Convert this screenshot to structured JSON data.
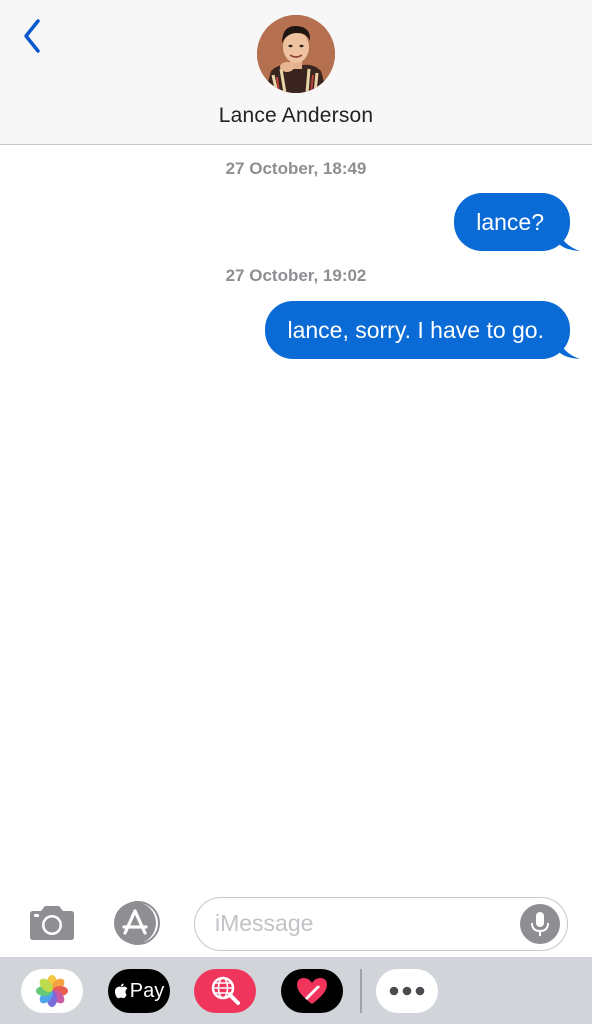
{
  "header": {
    "back_icon": "chevron-left-icon",
    "avatar_icon": "contact-photo",
    "contact_name": "Lance Anderson"
  },
  "messages": [
    {
      "timestamp": "27 October, 18:49",
      "text": "lance?",
      "direction": "outgoing"
    },
    {
      "timestamp": "27 October, 19:02",
      "text": "lance, sorry. I have to go.",
      "direction": "outgoing"
    }
  ],
  "compose": {
    "camera_icon": "camera-icon",
    "appstore_icon": "app-store-icon",
    "placeholder": "iMessage",
    "value": "",
    "mic_icon": "microphone-icon"
  },
  "drawer": {
    "apps": [
      {
        "name": "photos",
        "icon": "photos-flower-icon"
      },
      {
        "name": "apple-pay",
        "label": "Pay",
        "icon": "apple-logo-icon"
      },
      {
        "name": "images-search",
        "icon": "globe-magnifier-icon"
      },
      {
        "name": "digital-touch",
        "icon": "heart-icon"
      },
      {
        "name": "more",
        "icon": "ellipsis-icon"
      }
    ]
  },
  "colors": {
    "bubble_blue": "#0a6bd6",
    "accent_blue": "#0a57d0",
    "timestamp_gray": "#8e8e93",
    "header_bg": "#f7f7f7",
    "drawer_bg": "#d1d4d9"
  }
}
